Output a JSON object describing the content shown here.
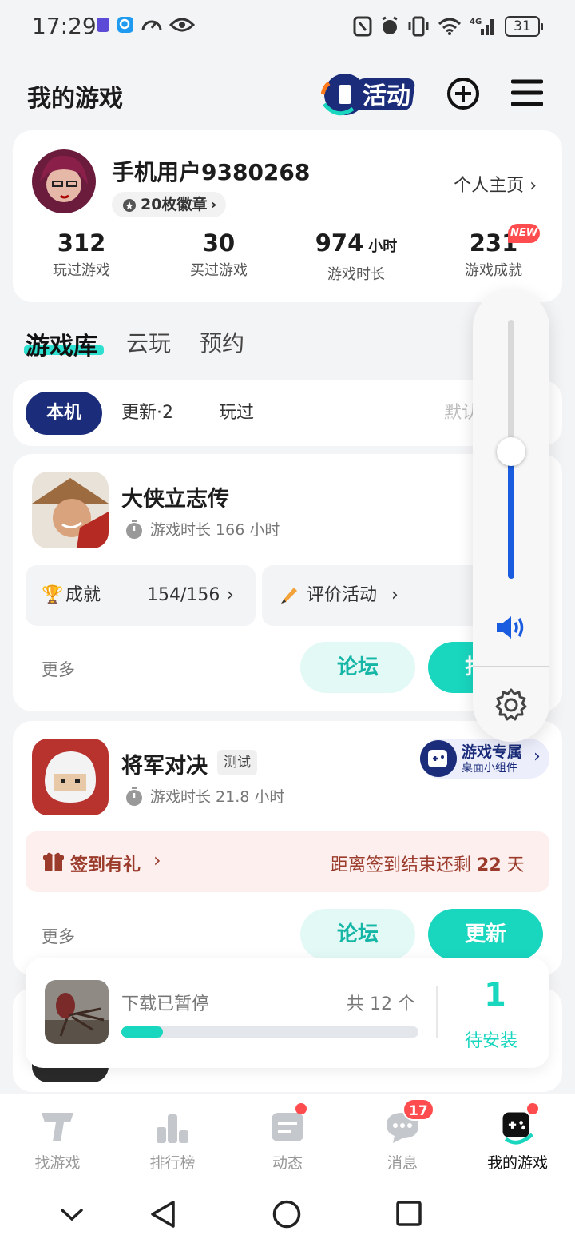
{
  "status_bar": {
    "time": "17:29",
    "battery": "31",
    "network": "4G"
  },
  "header": {
    "title": "我的游戏",
    "activity_label": "活动"
  },
  "profile": {
    "name": "手机用户9380268",
    "badges": "20枚徽章",
    "home_link": "个人主页",
    "stats": [
      {
        "value": "312",
        "unit": "",
        "label": "玩过游戏"
      },
      {
        "value": "30",
        "unit": "",
        "label": "买过游戏"
      },
      {
        "value": "974",
        "unit": "小时",
        "label": "游戏时长"
      },
      {
        "value": "231",
        "unit": "",
        "label": "游戏成就",
        "badge": "NEW"
      }
    ]
  },
  "tabs": [
    "游戏库",
    "云玩",
    "预约"
  ],
  "filters": [
    "本机",
    "更新·2",
    "玩过"
  ],
  "sort_label": "默认排序",
  "games": [
    {
      "name": "大侠立志传",
      "play_time": "游戏时长 166 小时",
      "achievement_label": "成就",
      "achievement_value": "154/156",
      "review_label": "评价活动",
      "more": "更多",
      "forum": "论坛",
      "action": "打开"
    },
    {
      "name": "将军对决",
      "tag": "测试",
      "play_time": "游戏时长 21.8 小时",
      "widget_title": "游戏专属",
      "widget_sub": "桌面小组件",
      "signin_label": "签到有礼",
      "signin_remaining_prefix": "距离签到结束还剩",
      "signin_days": "22",
      "signin_suffix": "天",
      "more": "更多",
      "forum": "论坛",
      "action": "更新"
    }
  ],
  "download": {
    "status": "下载已暂停",
    "total": "共 12 个",
    "progress": 0.14,
    "pending_count": "1",
    "pending_label": "待安装"
  },
  "volume": {
    "level": 0.49
  },
  "nav": [
    {
      "label": "找游戏",
      "icon": "find-game-icon"
    },
    {
      "label": "排行榜",
      "icon": "ranking-icon"
    },
    {
      "label": "动态",
      "icon": "feed-icon"
    },
    {
      "label": "消息",
      "icon": "message-icon",
      "badge": "17"
    },
    {
      "label": "我的游戏",
      "icon": "my-games-icon"
    }
  ],
  "colors": {
    "accent": "#19d6bf",
    "navy": "#1b2d7a",
    "volume_blue": "#1a5ce0",
    "red_badge": "#ff4d4f"
  }
}
